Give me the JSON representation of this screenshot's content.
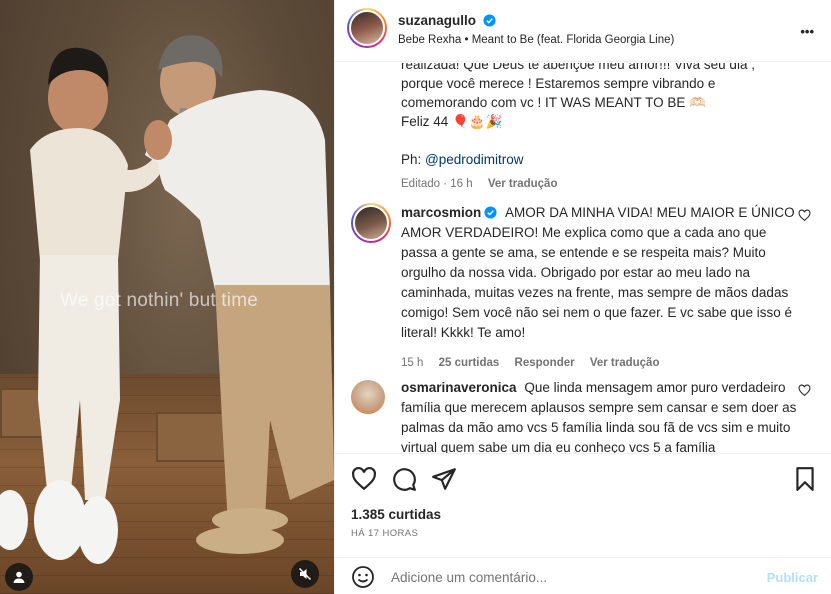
{
  "media": {
    "overlay_text": "We got nothin' but time"
  },
  "header": {
    "username": "suzanagullo",
    "audio": "Bebe Rexha • Meant to Be (feat. Florida Georgia Line)",
    "more": "•••"
  },
  "caption": {
    "line1": "realizada! Que Deus te abençoe meu amor!!! Viva seu dia ,",
    "line2": "porque você merece ! Estaremos sempre vibrando e",
    "line3": "comemorando com vc ! IT WAS MEANT TO BE 🫶🏻",
    "line4": "Feliz 44 🎈🎂🎉",
    "photo_label": "Ph: ",
    "photo_handle": "@pedrodimitrow",
    "meta_edited": "Editado · 16 h",
    "meta_translate": "Ver tradução"
  },
  "comments": [
    {
      "username": "marcosmion",
      "text": "AMOR DA MINHA VIDA! MEU MAIOR E ÚNICO AMOR VERDADEIRO! Me explica como que a cada ano que passa a gente se ama, se entende e se respeita mais? Muito orgulho da nossa vida. Obrigado por estar ao meu lado na caminhada, muitas vezes na frente, mas sempre de mãos dadas comigo! Sem você não sei nem o que fazer. E vc sabe que isso é literal! Kkkk! Te amo!",
      "time": "15 h",
      "likes": "25 curtidas",
      "reply": "Responder",
      "translate": "Ver tradução"
    },
    {
      "username": "osmarinaveronica",
      "text": "Que linda mensagem amor puro verdadeiro família que merecem aplausos sempre sem cansar e sem doer as palmas da mão amo vcs 5 família linda sou fã de vcs sim e muito virtual quem sabe um dia eu conheço vcs 5 a família"
    }
  ],
  "footer": {
    "likes": "1.385 curtidas",
    "time": "HÁ 17 HORAS",
    "comment_placeholder": "Adicione um comentário...",
    "publish": "Publicar"
  },
  "colors": {
    "link": "#00376b",
    "verified": "#0095f6",
    "publish_disabled": "#b2dffc"
  }
}
